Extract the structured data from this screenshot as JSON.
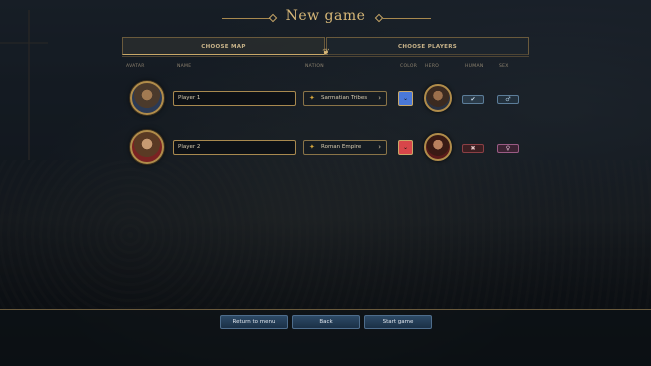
{
  "title": "New game",
  "tabs": {
    "map_label": "CHOOSE MAP",
    "players_label": "CHOOSE PLAYERS"
  },
  "headers": {
    "avatar": "AVATAR",
    "name": "NAME",
    "nation": "NATION",
    "color": "COLOR",
    "hero": "HERO",
    "human": "HUMAN",
    "sex": "SEX"
  },
  "players": [
    {
      "name": "Player 1",
      "nation": "Sarmatian Tribes",
      "color": "#4a78d8",
      "human_icon": "check-icon",
      "sex_icon": "male-icon"
    },
    {
      "name": "Player 2",
      "nation": "Roman Empire",
      "color": "#d8464a",
      "human_icon": "close-icon",
      "sex_icon": "female-icon"
    }
  ],
  "bottom": {
    "return_label": "Return to menu",
    "back_label": "Back",
    "start_label": "Start game"
  }
}
